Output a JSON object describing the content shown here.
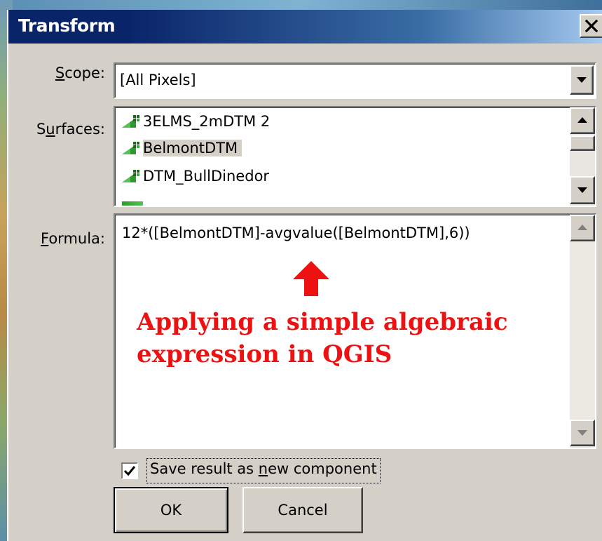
{
  "window": {
    "title": "Transform",
    "close_glyph": "×"
  },
  "scope": {
    "label_prefix": "",
    "label_mnemonic": "S",
    "label_rest": "cope:",
    "value": "[All Pixels]"
  },
  "surfaces": {
    "label_pre": "S",
    "label_mnemonic": "u",
    "label_rest": "rfaces:",
    "items": [
      {
        "label": "3ELMS_2mDTM 2",
        "icon": "raster-surface-icon"
      },
      {
        "label": "BelmontDTM",
        "icon": "raster-surface-icon",
        "selected": true
      },
      {
        "label": "DTM_BullDinedor",
        "icon": "raster-surface-icon"
      }
    ]
  },
  "formula": {
    "label_mnemonic": "F",
    "label_rest": "ormula:",
    "value": "12*([BelmontDTM]-avgvalue([BelmontDTM],6))"
  },
  "annotation": {
    "line1": "Applying a simple algebraic",
    "line2": "expression in QGIS",
    "color": "#ee1111"
  },
  "save_option": {
    "checked": true,
    "label_pre": "Save result as ",
    "label_mnemonic": "n",
    "label_rest": "ew component"
  },
  "buttons": {
    "ok": "OK",
    "cancel": "Cancel"
  },
  "colors": {
    "dialog_face": "#d4d0c8",
    "title_start": "#0a246a",
    "title_end": "#a6caf0"
  }
}
